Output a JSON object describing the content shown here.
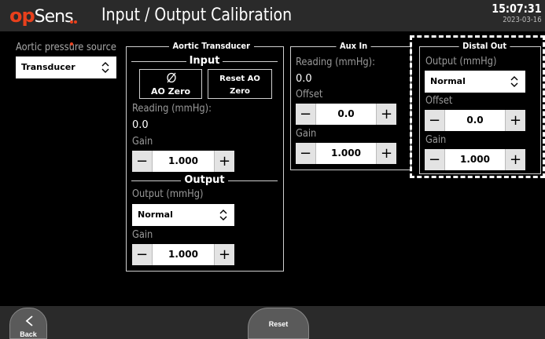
{
  "header": {
    "logo_op": "op",
    "logo_sens": "Sens",
    "title": "Input / Output Calibration",
    "time": "15:07:31",
    "date": "2023-03-16"
  },
  "aortic_source": {
    "label": "Aortic pressure source",
    "selected": "Transducer"
  },
  "aortic_transducer": {
    "title": "Aortic Transducer",
    "input": {
      "heading": "Input",
      "ao_zero_label": "AO Zero",
      "reset_ao_label_1": "Reset AO",
      "reset_ao_label_2": "Zero",
      "reading_label": "Reading (mmHg):",
      "reading_value": "0.0",
      "gain_label": "Gain",
      "gain_value": "1.000"
    },
    "output": {
      "heading": "Output",
      "output_label": "Output (mmHg)",
      "output_selected": "Normal",
      "gain_label": "Gain",
      "gain_value": "1.000"
    }
  },
  "aux_in": {
    "title": "Aux In",
    "reading_label": "Reading (mmHg):",
    "reading_value": "0.0",
    "offset_label": "Offset",
    "offset_value": "0.0",
    "gain_label": "Gain",
    "gain_value": "1.000"
  },
  "distal_out": {
    "title": "Distal Out",
    "output_label": "Output (mmHg)",
    "output_selected": "Normal",
    "offset_label": "Offset",
    "offset_value": "0.0",
    "gain_label": "Gain",
    "gain_value": "1.000"
  },
  "stepper": {
    "minus": "−",
    "plus": "+"
  },
  "footer": {
    "back_label": "Back",
    "reset_label": "Reset"
  },
  "colors": {
    "brand_orange": "#e8401c",
    "header_bg": "#2a2a2a",
    "panel_border": "#cfcfcf",
    "label_gray": "#9a9a9a"
  },
  "icons": [
    "back-chevron-icon",
    "zero-slash-icon",
    "select-chevron-icon"
  ]
}
